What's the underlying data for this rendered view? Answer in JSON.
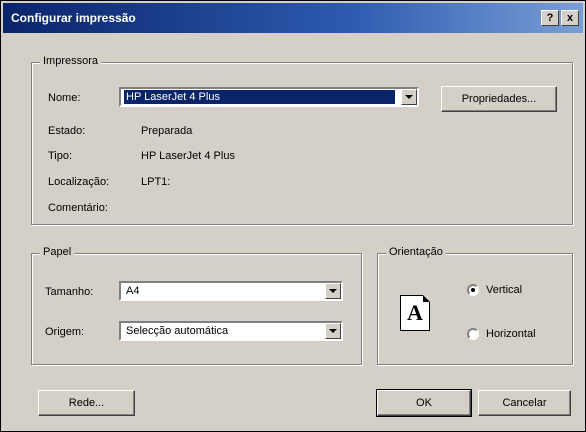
{
  "window": {
    "title": "Configurar impressão",
    "help_button": "?",
    "close_button": "x"
  },
  "printer_group": {
    "label": "Impressora",
    "name_label": "Nome:",
    "name_value": "HP LaserJet 4 Plus",
    "properties_button": "Propriedades...",
    "status_label": "Estado:",
    "status_value": "Preparada",
    "type_label": "Tipo:",
    "type_value": "HP LaserJet 4 Plus",
    "location_label": "Localização:",
    "location_value": "LPT1:",
    "comment_label": "Comentário:"
  },
  "paper_group": {
    "label": "Papel",
    "size_label": "Tamanho:",
    "size_value": "A4",
    "source_label": "Origem:",
    "source_value": "Selecção automática"
  },
  "orientation_group": {
    "label": "Orientação",
    "page_glyph": "A",
    "vertical_label": "Vertical",
    "horizontal_label": "Horizontal",
    "selected": "vertical"
  },
  "footer": {
    "network_button": "Rede...",
    "ok_button": "OK",
    "cancel_button": "Cancelar"
  }
}
